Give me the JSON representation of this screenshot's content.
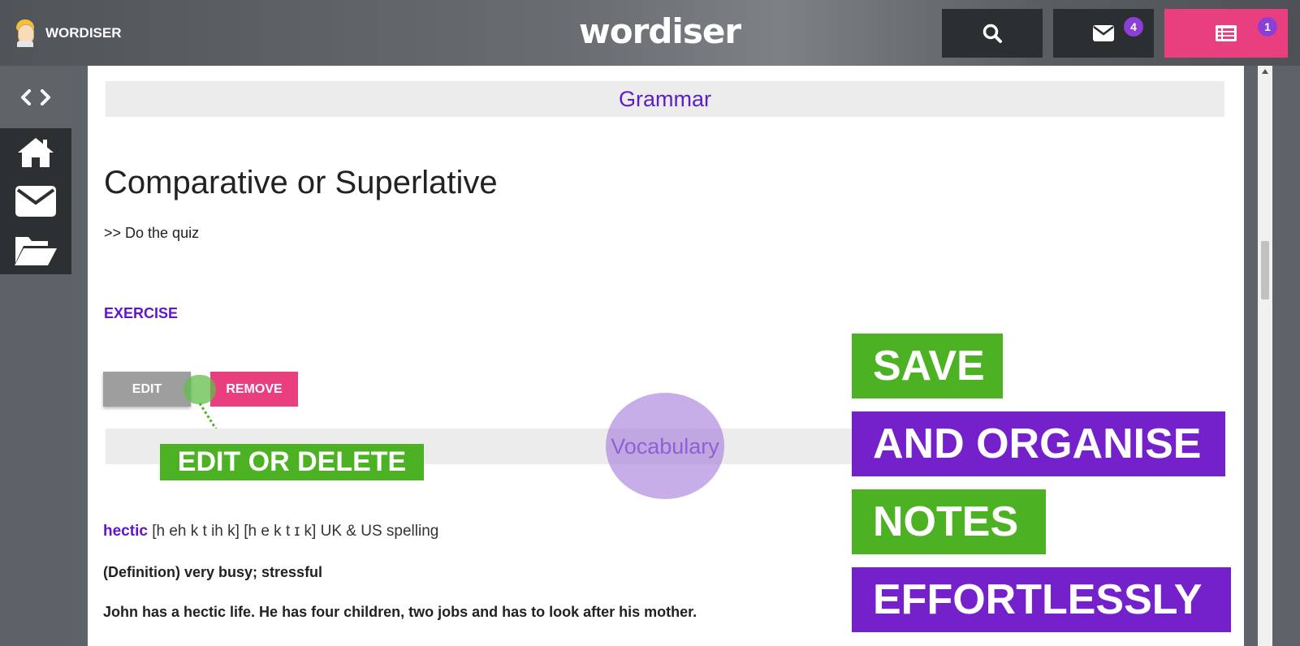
{
  "header": {
    "brand": "WORDISER",
    "logo": "wordiser",
    "search_icon": "search-icon",
    "messages_icon": "envelope-icon",
    "messages_count": "4",
    "notes_icon": "notes-icon",
    "notes_count": "1"
  },
  "sidebar": {
    "toggle_icon": "code-arrows-icon",
    "items": [
      {
        "icon": "home-icon"
      },
      {
        "icon": "envelope-icon"
      },
      {
        "icon": "folder-open-icon"
      }
    ]
  },
  "main": {
    "grammar_heading": "Grammar",
    "title": "Comparative or Superlative",
    "quiz_link": ">> Do the quiz",
    "exercise_label": "EXERCISE",
    "edit_label": "EDIT",
    "remove_label": "REMOVE",
    "vocab_heading": "Vocabulary",
    "word": "hectic",
    "pronunciation": "[h eh k t ih k] [h e k t ɪ k] UK & US spelling",
    "definition": "(Definition) very busy; stressful",
    "example": "John has a hectic life. He has four children, two jobs and has to look after his mother."
  },
  "overlay": {
    "callout": "EDIT OR DELETE",
    "line1": "SAVE",
    "line2": "AND ORGANISE",
    "line3": "NOTES",
    "line4": "EFFORTLESSLY"
  },
  "colors": {
    "accent_purple": "#6216c9",
    "pink": "#ea3f7f",
    "green": "#4cb223",
    "purple": "#7421cc"
  }
}
